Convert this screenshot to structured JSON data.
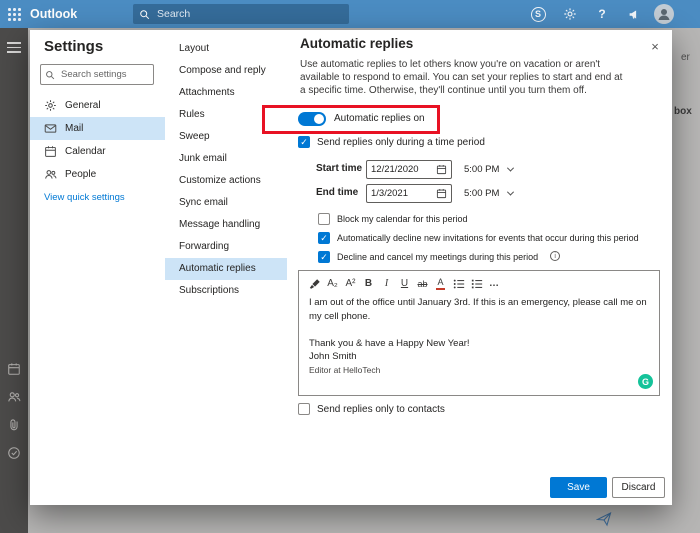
{
  "topbar": {
    "app_name": "Outlook",
    "search_placeholder": "Search"
  },
  "settings_nav": {
    "title": "Settings",
    "search_placeholder": "Search settings",
    "items": [
      {
        "label": "General",
        "selected": false
      },
      {
        "label": "Mail",
        "selected": true
      },
      {
        "label": "Calendar",
        "selected": false
      },
      {
        "label": "People",
        "selected": false
      }
    ],
    "quick_settings_link": "View quick settings"
  },
  "mail_nav": {
    "items": [
      "Layout",
      "Compose and reply",
      "Attachments",
      "Rules",
      "Sweep",
      "Junk email",
      "Customize actions",
      "Sync email",
      "Message handling",
      "Forwarding",
      "Automatic replies",
      "Subscriptions"
    ],
    "selected": "Automatic replies"
  },
  "panel": {
    "title": "Automatic replies",
    "description": "Use automatic replies to let others know you're on vacation or aren't available to respond to email. You can set your replies to start and end at a specific time. Otherwise, they'll continue until you turn them off.",
    "toggle_label": "Automatic replies on",
    "toggle_state": "on",
    "time_period_checkbox": {
      "label": "Send replies only during a time period",
      "checked": true
    },
    "start_time_label": "Start time",
    "start_date": "12/21/2020",
    "start_time": "5:00 PM",
    "end_time_label": "End time",
    "end_date": "1/3/2021",
    "end_time": "5:00 PM",
    "options": [
      {
        "label": "Block my calendar for this period",
        "checked": false
      },
      {
        "label": "Automatically decline new invitations for events that occur during this period",
        "checked": true
      },
      {
        "label": "Decline and cancel my meetings during this period",
        "checked": true,
        "has_info": true
      }
    ],
    "message_lines": [
      "I am out of the office until January 3rd. If this is an emergency, please call me on my cell phone.",
      "",
      "Thank you & have a Happy New Year!",
      "John Smith",
      "Editor at HelloTech"
    ],
    "contacts_checkbox": {
      "label": "Send replies only to contacts",
      "checked": false
    },
    "save_button": "Save",
    "discard_button": "Discard"
  },
  "background": {
    "fragments": [
      "er",
      "box"
    ]
  },
  "icons": {
    "skype": "S",
    "help": "?",
    "close": "×",
    "checkmark": "✓",
    "more": "…",
    "bold": "B",
    "italic": "I",
    "underline": "U",
    "strikethrough": "ab",
    "font_color": "A",
    "subscript": "A₂",
    "superscript": "A²",
    "info": "i",
    "grammarly": "G"
  },
  "colors": {
    "accent": "#0078d4",
    "selected_bg": "#cde4f7",
    "annotation": "#e81123",
    "grammarly": "#15c39a"
  }
}
